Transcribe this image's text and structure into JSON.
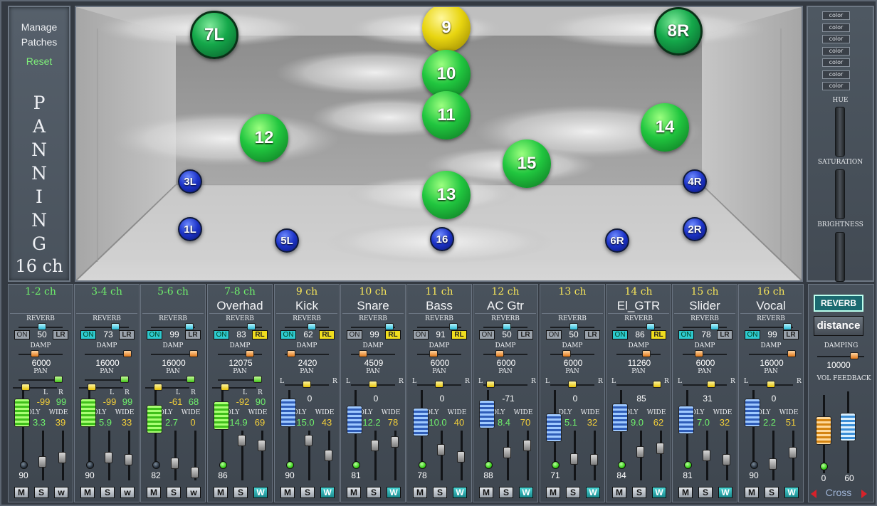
{
  "left_panel": {
    "manage_patches": "Manage\nPatches",
    "reset": "Reset",
    "title_letters": [
      "P",
      "A",
      "N",
      "N",
      "I",
      "N",
      "G"
    ],
    "subtitle": "16 ch"
  },
  "room": {
    "balls": [
      {
        "label": "7L",
        "kind": "gb",
        "size": "big"
      },
      {
        "label": "9",
        "kind": "y",
        "size": "big"
      },
      {
        "label": "8R",
        "kind": "gb",
        "size": "big"
      },
      {
        "label": "10",
        "kind": "g",
        "size": "big"
      },
      {
        "label": "11",
        "kind": "g",
        "size": "big"
      },
      {
        "label": "12",
        "kind": "g",
        "size": "big"
      },
      {
        "label": "14",
        "kind": "g",
        "size": "big"
      },
      {
        "label": "15",
        "kind": "g",
        "size": "big"
      },
      {
        "label": "13",
        "kind": "g",
        "size": "big"
      },
      {
        "label": "3L",
        "kind": "b",
        "size": "sm"
      },
      {
        "label": "4R",
        "kind": "b",
        "size": "sm"
      },
      {
        "label": "1L",
        "kind": "b",
        "size": "sm"
      },
      {
        "label": "2R",
        "kind": "b",
        "size": "sm"
      },
      {
        "label": "5L",
        "kind": "b",
        "size": "sm"
      },
      {
        "label": "16",
        "kind": "b",
        "size": "sm"
      },
      {
        "label": "6R",
        "kind": "b",
        "size": "sm"
      }
    ]
  },
  "right_panel": {
    "color_buttons": [
      "color",
      "color",
      "color",
      "color",
      "color",
      "color",
      "color"
    ],
    "hue": "HUE",
    "saturation": "SATURATION",
    "brightness": "BRIGHTNESS"
  },
  "labels": {
    "reverb": "REVERB",
    "damp": "DAMP",
    "pan": "PAN",
    "dly": "DLY",
    "wide": "WIDE",
    "l": "L",
    "r": "R",
    "m": "M",
    "s": "S",
    "w": "w",
    "W": "W"
  },
  "channels": [
    {
      "num": "1-2 ch",
      "name": "",
      "stereo": true,
      "on": false,
      "reverb": "50",
      "lr": "LR",
      "lr_lit": false,
      "damp": "6000",
      "l": "-99",
      "r": "99",
      "dly": "3.3",
      "wide": "39",
      "vol": "90",
      "led": false,
      "w_lit": false,
      "fader": "green"
    },
    {
      "num": "3-4 ch",
      "name": "",
      "stereo": true,
      "on": true,
      "reverb": "73",
      "lr": "LR",
      "lr_lit": false,
      "damp": "16000",
      "l": "-99",
      "r": "99",
      "dly": "5.9",
      "wide": "33",
      "vol": "90",
      "led": false,
      "w_lit": false,
      "fader": "green"
    },
    {
      "num": "5-6 ch",
      "name": "",
      "stereo": true,
      "on": true,
      "reverb": "99",
      "lr": "LR",
      "lr_lit": false,
      "damp": "16000",
      "l": "-61",
      "r": "68",
      "dly": "2.7",
      "wide": "0",
      "vol": "82",
      "led": false,
      "w_lit": false,
      "fader": "green"
    },
    {
      "num": "7-8 ch",
      "name": "Overhad",
      "stereo": true,
      "on": true,
      "reverb": "83",
      "lr": "RL",
      "lr_lit": true,
      "damp": "12075",
      "l": "-92",
      "r": "90",
      "dly": "14.9",
      "wide": "69",
      "vol": "86",
      "led": true,
      "w_lit": true,
      "fader": "green"
    },
    {
      "num": "9 ch",
      "name": "Kick",
      "stereo": false,
      "on": true,
      "reverb": "62",
      "lr": "RL",
      "lr_lit": true,
      "damp": "2420",
      "pan": "0",
      "dly": "15.0",
      "wide": "43",
      "vol": "90",
      "led": true,
      "w_lit": true,
      "fader": "blue"
    },
    {
      "num": "10 ch",
      "name": "Snare",
      "stereo": false,
      "on": false,
      "reverb": "99",
      "lr": "RL",
      "lr_lit": true,
      "damp": "4509",
      "pan": "0",
      "dly": "12.2",
      "wide": "78",
      "vol": "81",
      "led": true,
      "w_lit": true,
      "fader": "blue"
    },
    {
      "num": "11 ch",
      "name": "Bass",
      "stereo": false,
      "on": false,
      "reverb": "91",
      "lr": "RL",
      "lr_lit": true,
      "damp": "6000",
      "pan": "0",
      "dly": "10.0",
      "wide": "40",
      "vol": "78",
      "led": true,
      "w_lit": true,
      "fader": "blue"
    },
    {
      "num": "12 ch",
      "name": "AC Gtr",
      "stereo": false,
      "on": false,
      "reverb": "50",
      "lr": "LR",
      "lr_lit": false,
      "damp": "6000",
      "pan": "-71",
      "dly": "8.4",
      "wide": "70",
      "vol": "88",
      "led": true,
      "w_lit": true,
      "fader": "blue"
    },
    {
      "num": "13 ch",
      "name": "",
      "stereo": false,
      "on": false,
      "reverb": "50",
      "lr": "LR",
      "lr_lit": false,
      "damp": "6000",
      "pan": "0",
      "dly": "5.1",
      "wide": "32",
      "vol": "71",
      "led": true,
      "w_lit": true,
      "fader": "blue"
    },
    {
      "num": "14 ch",
      "name": "El_GTR",
      "stereo": false,
      "on": true,
      "reverb": "86",
      "lr": "RL",
      "lr_lit": true,
      "damp": "11260",
      "pan": "85",
      "dly": "9.0",
      "wide": "62",
      "vol": "84",
      "led": true,
      "w_lit": true,
      "fader": "blue"
    },
    {
      "num": "15 ch",
      "name": "Slider",
      "stereo": false,
      "on": true,
      "reverb": "78",
      "lr": "LR",
      "lr_lit": false,
      "damp": "6000",
      "pan": "31",
      "dly": "7.0",
      "wide": "32",
      "vol": "81",
      "led": true,
      "w_lit": true,
      "fader": "blue"
    },
    {
      "num": "16 ch",
      "name": "Vocal",
      "stereo": false,
      "on": true,
      "reverb": "99",
      "lr": "LR",
      "lr_lit": false,
      "damp": "16000",
      "pan": "0",
      "dly": "2.2",
      "wide": "51",
      "vol": "90",
      "led": false,
      "w_lit": true,
      "fader": "blue"
    }
  ],
  "master": {
    "reverb_btn": "REVERB",
    "distance_btn": "distance",
    "damping_label": "DAMPING",
    "damping_value": "10000",
    "vol_feedback_label": "VOL FEEDBACK",
    "vol_value": "0",
    "feedback_value": "60",
    "cross_label": "Cross"
  },
  "colors": {
    "accent_green": "#6ff06c",
    "accent_yellow": "#f5e45a",
    "on_cyan": "#2ec9cf",
    "lr_yellow": "#f0dd1e",
    "room_gray": "#c8c8c8"
  }
}
